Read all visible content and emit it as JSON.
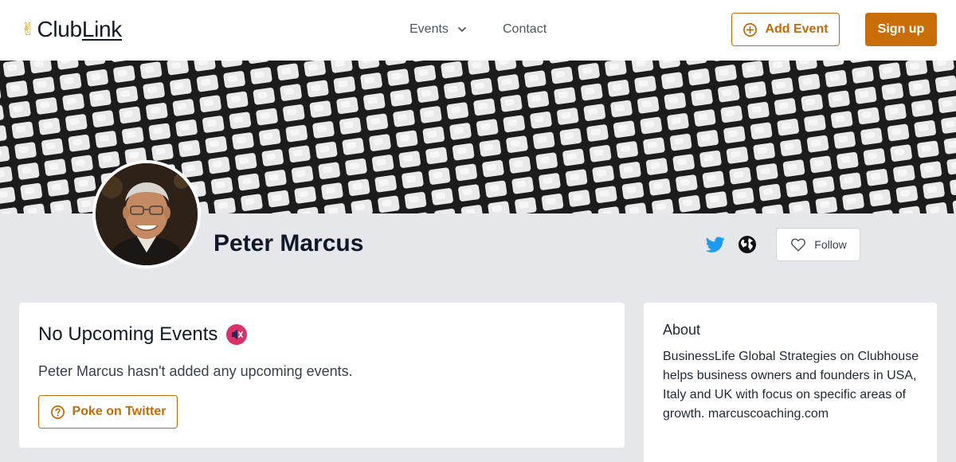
{
  "header": {
    "logo_emoji": "✌",
    "logo_club": "Club",
    "logo_link": "Link",
    "nav_events": "Events",
    "nav_contact": "Contact",
    "add_event_label": "Add Event",
    "signup_label": "Sign up"
  },
  "profile": {
    "name": "Peter Marcus",
    "follow_label": "Follow"
  },
  "events_card": {
    "title": "No Upcoming Events",
    "subtitle": "Peter Marcus hasn't added any upcoming events.",
    "poke_label": "Poke on Twitter"
  },
  "about_card": {
    "title": "About",
    "body": "BusinessLife Global Strategies on Clubhouse helps business owners and founders in USA, Italy and UK with focus on specific areas of growth. marcuscoaching.com"
  },
  "colors": {
    "accent": "#c86d08",
    "twitter": "#1d9bf0",
    "page_bg": "#e5e7eb"
  },
  "icons": [
    "victory-hand-icon",
    "chevron-down-icon",
    "plus-circle-icon",
    "twitter-icon",
    "globe-icon",
    "heart-icon",
    "muted-speaker-icon",
    "question-circle-icon"
  ]
}
